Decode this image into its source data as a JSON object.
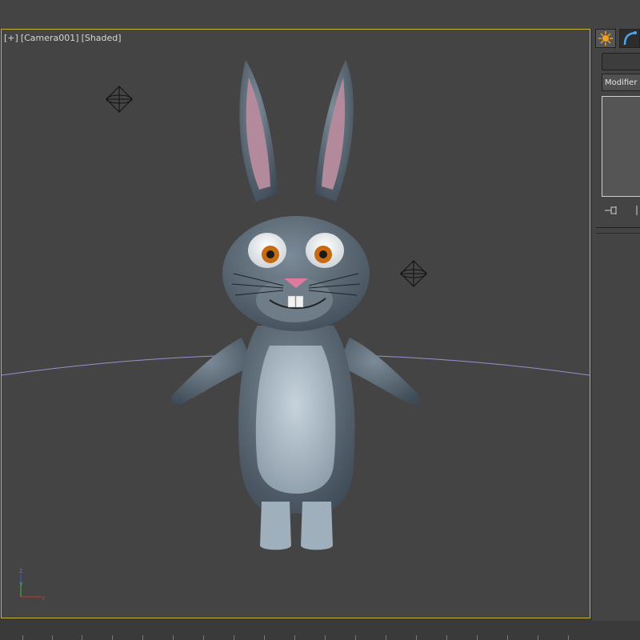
{
  "viewport": {
    "label_plus": "[+]",
    "label_camera": "[Camera001]",
    "label_mode": "[Shaded]",
    "border_color": "#c8b431"
  },
  "scene": {
    "subject": "cartoon-rabbit",
    "rabbit_body_color": "#5d6b78",
    "rabbit_belly_color": "#a9b8c4",
    "ear_inner_color": "#b28a9c",
    "eye_iris_color": "#c76a10",
    "nose_color": "#e07a9c",
    "horizon_color": "#9b8fd0",
    "light_icons": [
      "light-gizmo-icon",
      "light-gizmo-icon"
    ],
    "axis_labels": {
      "z": "z",
      "y": "y",
      "x": "x"
    }
  },
  "command_panel": {
    "tab_icons": [
      "create-icon",
      "modify-icon"
    ],
    "modifier_list_label": "Modifier L",
    "stack_icons": [
      "pin-stack-icon",
      "show-end-result-icon"
    ]
  }
}
